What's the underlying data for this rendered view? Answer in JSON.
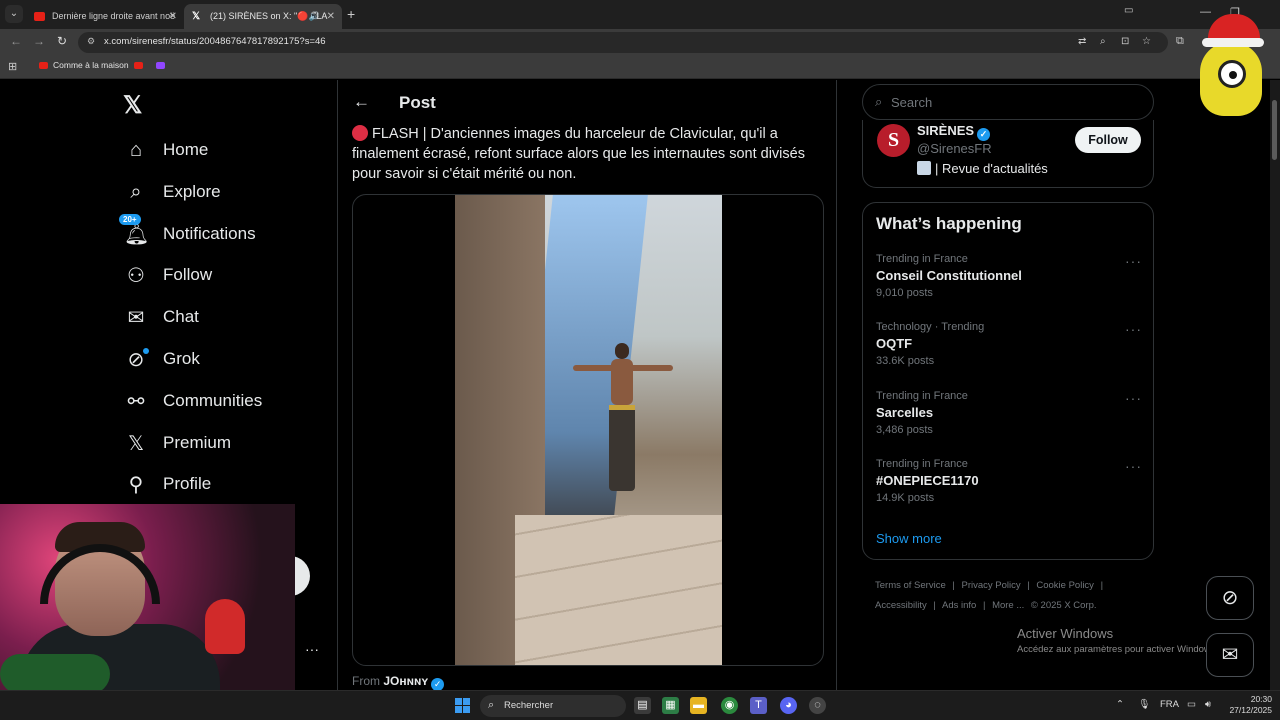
{
  "browser": {
    "tabs": [
      {
        "title": "Dernière ligne droite avant noë",
        "active": false
      },
      {
        "title": "(21) SIRÈNES on X: \"🔴 FLA",
        "active": true
      }
    ],
    "url": "x.com/sirenesfr/status/2004867647817892175?s=46",
    "bookmarks": [
      {
        "label": "Comme à la maison",
        "icon": "youtube"
      },
      {
        "label": "",
        "icon": "youtube"
      },
      {
        "label": "",
        "icon": "twitch"
      }
    ]
  },
  "nav": {
    "items": [
      {
        "label": "Home",
        "icon": "home-icon"
      },
      {
        "label": "Explore",
        "icon": "search-icon"
      },
      {
        "label": "Notifications",
        "icon": "bell-icon",
        "badge": "20+"
      },
      {
        "label": "Follow",
        "icon": "add-user-icon"
      },
      {
        "label": "Chat",
        "icon": "mail-icon"
      },
      {
        "label": "Grok",
        "icon": "grok-icon"
      },
      {
        "label": "Communities",
        "icon": "communities-icon"
      },
      {
        "label": "Premium",
        "icon": "x-icon"
      },
      {
        "label": "Profile",
        "icon": "person-icon"
      }
    ]
  },
  "post": {
    "header": "Post",
    "text": "FLASH | D'anciennes images du harceleur de Clavicular, qu'il a finalement écrasé, refont surface alors que les internautes sont divisés pour savoir si c'était mérité ou non.",
    "from_prefix": "From",
    "from_name": "JOʜɴɴʏ"
  },
  "sidebar": {
    "search_placeholder": "Search",
    "profile": {
      "avatar_letter": "S",
      "name": "SIRÈNES",
      "handle": "@SirenesFR",
      "bio": "| Revue d'actualités",
      "follow_label": "Follow"
    },
    "trends_title": "What’s happening",
    "trends": [
      {
        "context": "Trending in France",
        "name": "Conseil Constitutionnel",
        "count": "9,010 posts"
      },
      {
        "context": "Technology · Trending",
        "name": "OQTF",
        "count": "33.6K posts"
      },
      {
        "context": "Trending in France",
        "name": "Sarcelles",
        "count": "3,486 posts"
      },
      {
        "context": "Trending in France",
        "name": "#ONEPIECE1170",
        "count": "14.9K posts"
      }
    ],
    "show_more": "Show more",
    "footer": [
      "Terms of Service",
      "|",
      "Privacy Policy",
      "|",
      "Cookie Policy",
      "|",
      "Accessibility",
      "|",
      "Ads info",
      "|",
      "More ...",
      "© 2025 X Corp."
    ]
  },
  "windows": {
    "activate_title": "Activer Windows",
    "activate_sub": "Accédez aux paramètres pour activer Windows.",
    "search_label": "Rechercher",
    "lang": "FRA",
    "time": "20:30",
    "date": "27/12/2025"
  },
  "colors": {
    "accent": "#1d9bf0",
    "background": "#000000",
    "text": "#e7e9ea",
    "muted": "#71767b"
  }
}
